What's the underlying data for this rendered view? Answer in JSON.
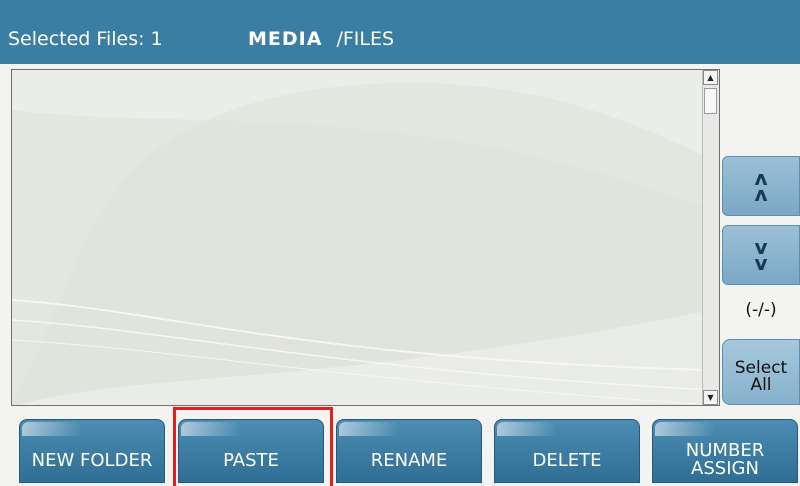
{
  "header": {
    "selected_label": "Selected Files:",
    "selected_count": "1",
    "path_root": "MEDIA",
    "path_sub": "/FILES"
  },
  "file_list": {
    "items": [],
    "scroll_up_icon": "triangle-up-icon",
    "scroll_down_icon": "triangle-down-icon"
  },
  "side_controls": {
    "page_up_icon": "double-chevron-up-icon",
    "page_down_icon": "double-chevron-down-icon",
    "page_counter": "(-/-)",
    "select_all_line1": "Select",
    "select_all_line2": "All"
  },
  "bottom_bar": {
    "new_folder": "NEW FOLDER",
    "paste": "PASTE",
    "rename": "RENAME",
    "delete": "DELETE",
    "number_assign_line1": "NUMBER",
    "number_assign_line2": "ASSIGN"
  },
  "colors": {
    "header_bg": "#3a7ea3",
    "button_bg": "#2f6e95",
    "side_button_bg": "#86b1cc",
    "highlight": "#e2201e"
  }
}
